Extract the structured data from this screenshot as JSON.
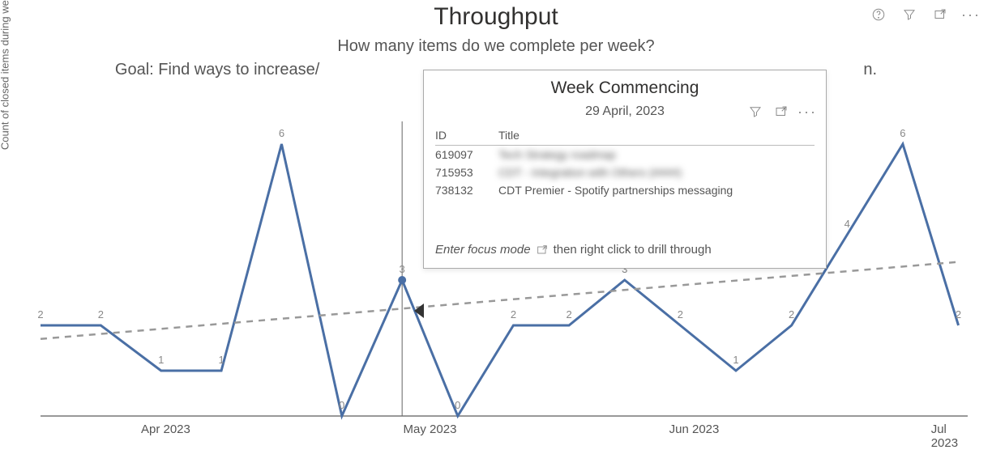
{
  "title": "Throughput",
  "subtitle": "How many items do we complete per week?",
  "goal_prefix": "Goal: Find ways to increase/",
  "goal_suffix": "n.",
  "y_axis_label": "Count of closed items during week",
  "toolbar": {
    "help_icon": "help-icon",
    "filter_icon": "filter-icon",
    "focus_icon": "focus-mode-icon",
    "more_icon": "more-options-icon"
  },
  "x_ticks": [
    {
      "label": "Apr 2023",
      "pct": 13.5
    },
    {
      "label": "May 2023",
      "pct": 42.0
    },
    {
      "label": "Jun 2023",
      "pct": 70.5
    },
    {
      "label": "Jul 2023",
      "pct": 97.5
    }
  ],
  "chart_data": {
    "type": "line",
    "xlabel": "",
    "ylabel": "Count of closed items during week",
    "ylim": [
      0,
      6.5
    ],
    "title": "Throughput",
    "series": [
      {
        "name": "Throughput",
        "color": "#4a6fa5",
        "x_pct": [
          0,
          6.5,
          13,
          19.5,
          26,
          32.5,
          39,
          45,
          51,
          57,
          63,
          69,
          75,
          81,
          87,
          93,
          99
        ],
        "values": [
          2,
          2,
          1,
          1,
          6,
          0,
          3,
          0,
          2,
          2,
          3,
          2,
          1,
          2,
          4,
          6,
          2
        ]
      },
      {
        "name": "Trend",
        "color": "#999",
        "style": "dashed",
        "x_pct": [
          0,
          99
        ],
        "values": [
          1.7,
          3.4
        ]
      }
    ],
    "highlight_point_index": 6
  },
  "tooltip": {
    "title": "Week Commencing",
    "subtitle": "29 April, 2023",
    "columns": [
      "ID",
      "Title"
    ],
    "rows": [
      {
        "id": "619097",
        "title": "Tech Strategy roadmap",
        "blurred": true
      },
      {
        "id": "715953",
        "title": "CDT - Integration with Others (####)",
        "blurred": true
      },
      {
        "id": "738132",
        "title": "CDT Premier - Spotify partnerships messaging",
        "blurred": false
      }
    ],
    "footer_italic": "Enter focus mode",
    "footer_rest": "then right click to drill through"
  }
}
